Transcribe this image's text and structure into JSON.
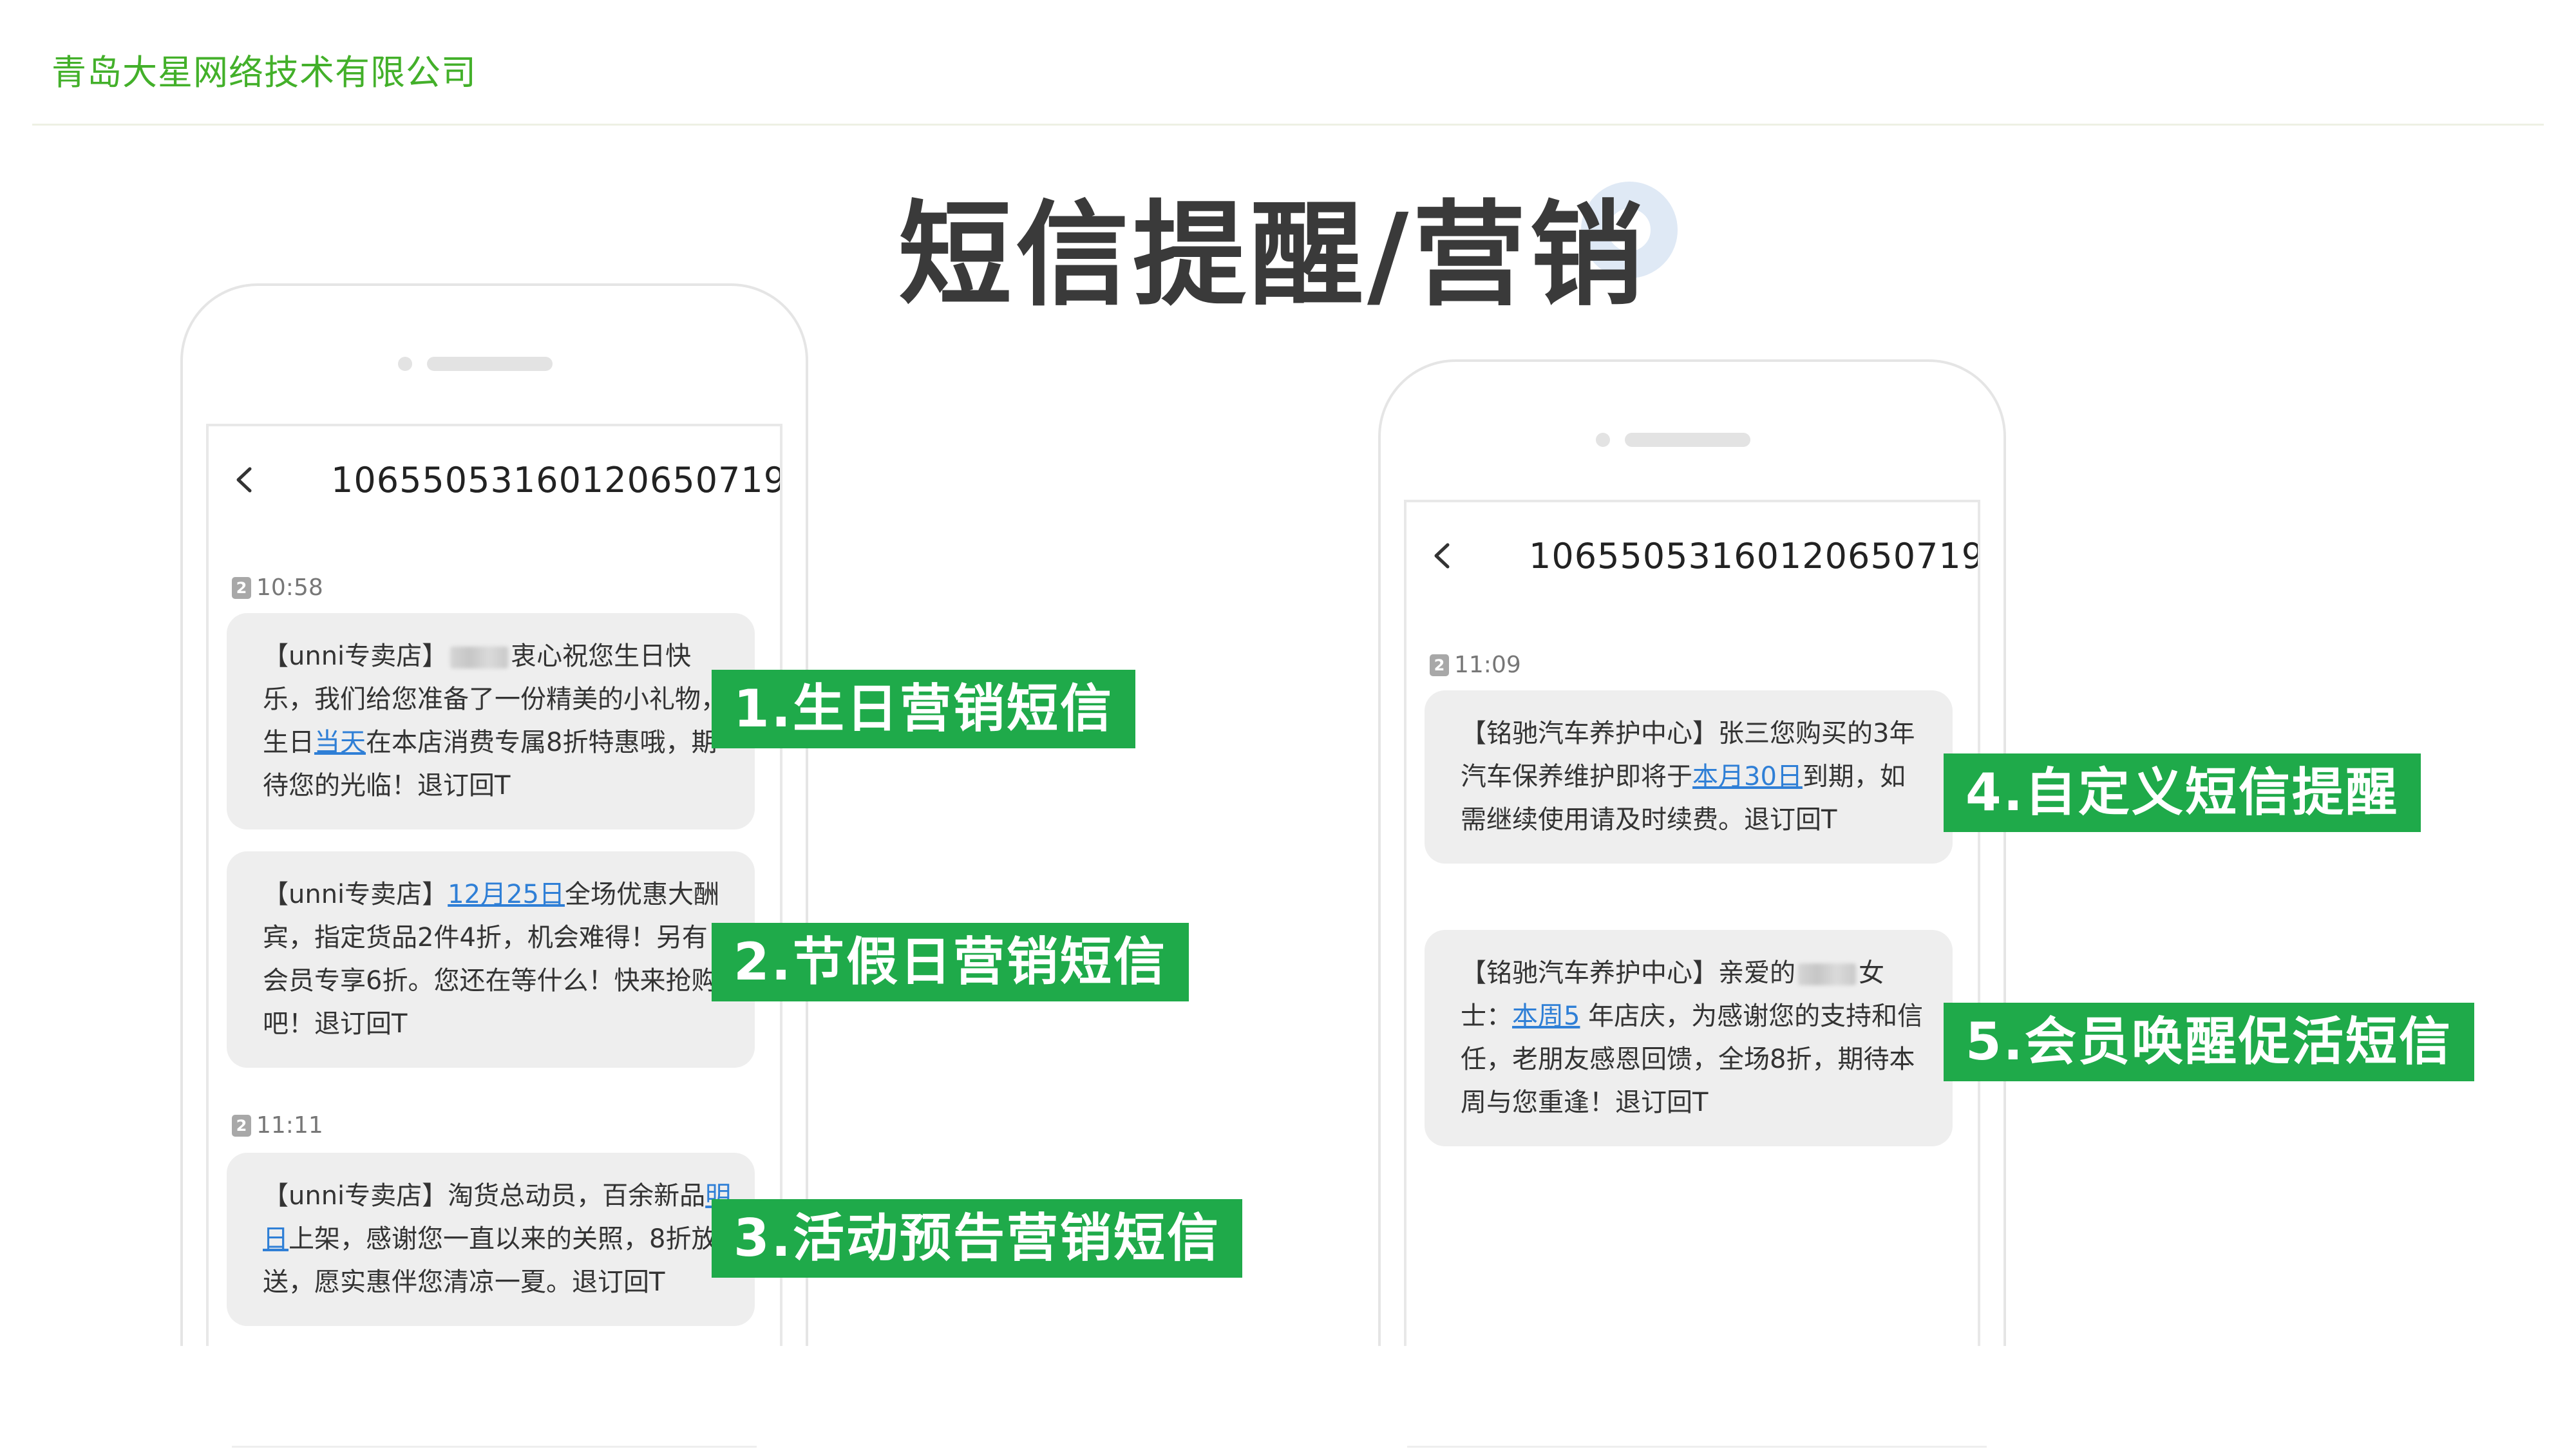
{
  "header": {
    "company": "青岛大星网络技术有限公司",
    "title": "短信提醒/营销"
  },
  "colors": {
    "brand_green": "#43b02a",
    "tag_green": "#1faa4a",
    "link_blue": "#2f7fd6",
    "bubble_gray": "#eeeeee"
  },
  "left_phone": {
    "sender": "10655053160120650719",
    "time1": "10:58",
    "time2": "11:11",
    "sim_slot": "2",
    "msg1": {
      "a": "【unni专卖店】",
      "b": "衷心祝您生日快乐，我们给您准备了一份精美的小礼物，生日",
      "link": "当天",
      "c": "在本店消费专属8折特惠哦，期待您的光临！退订回T"
    },
    "msg2": {
      "a": "【unni专卖店】",
      "link": "12月25日",
      "b": "全场优惠大酬宾，指定货品2件4折，机会难得！另有会员专享6折。您还在等什么！快来抢购吧！退订回T"
    },
    "msg3": {
      "a": "【unni专卖店】淘货总动员，百余新品",
      "link": "明日",
      "b": "上架，感谢您一直以来的关照，8折放送，愿实惠伴您清凉一夏。退订回T"
    }
  },
  "right_phone": {
    "sender": "10655053160120650719",
    "time1": "11:09",
    "sim_slot": "2",
    "msg1": {
      "a": "【铭驰汽车养护中心】张三您购买的3年汽车保养维护即将于",
      "link": "本月30日",
      "b": "到期，如需继续使用请及时续费。退订回T"
    },
    "msg2": {
      "a": "【铭驰汽车养护中心】亲爱的",
      "b": "女士：",
      "link": "本周5",
      "c": " 年店庆，为感谢您的支持和信任，老朋友感恩回馈，全场8折，期待本周与您重逢！退订回T"
    }
  },
  "tags": [
    "1.生日营销短信",
    "2.节假日营销短信",
    "3.活动预告营销短信",
    "4.自定义短信提醒",
    "5.会员唤醒促活短信"
  ],
  "icons": [
    "back-chevron-icon",
    "sim-badge-icon"
  ]
}
